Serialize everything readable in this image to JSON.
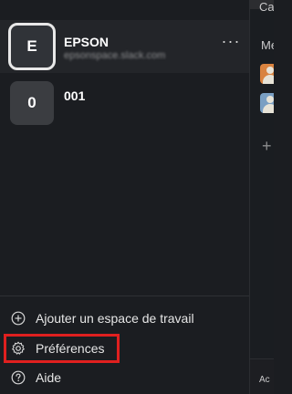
{
  "workspaces": [
    {
      "initial": "E",
      "name": "EPSON",
      "domain": "epsonspace.slack.com",
      "more_label": "···"
    },
    {
      "initial": "0",
      "name": "001"
    }
  ],
  "menu": {
    "add_workspace": "Ajouter un espace de travail",
    "preferences": "Préférences",
    "help": "Aide"
  },
  "behind_panel": {
    "top_peek": "Ca",
    "section_peek": "Me",
    "bottom_peek": "Ac"
  },
  "colors": {
    "highlight": "#e0201f",
    "drawer_bg": "#1b1d21"
  }
}
